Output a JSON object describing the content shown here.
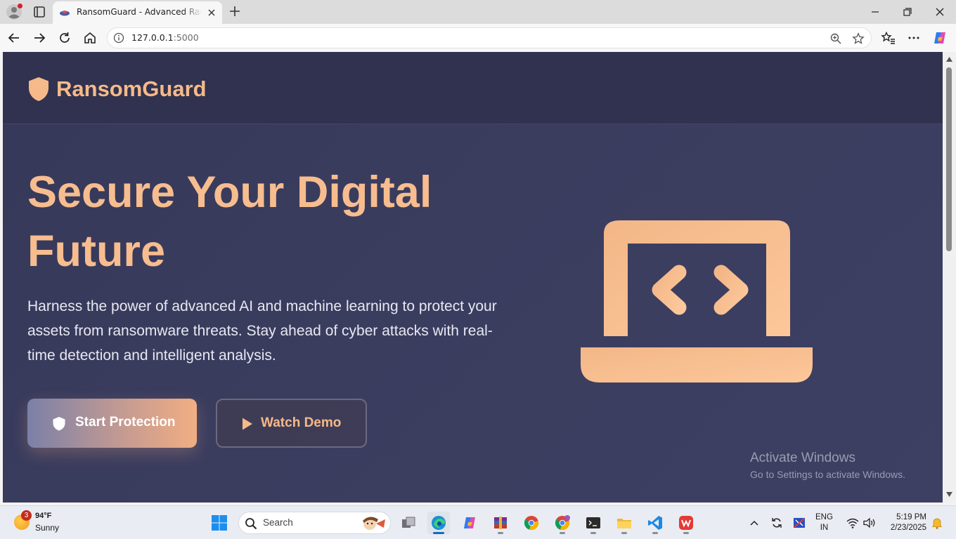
{
  "browser": {
    "tab_title": "RansomGuard - Advanced Ransomware Protection",
    "url_host": "127.0.0.1",
    "url_port": ":5000"
  },
  "site": {
    "brand": "RansomGuard",
    "hero_title": "Secure Your Digital Future",
    "hero_description": "Harness the power of advanced AI and machine learning to protect your assets from ransomware threats. Stay ahead of cyber attacks with real-time detection and intelligent analysis.",
    "primary_button": "Start Protection",
    "secondary_button": "Watch Demo",
    "accent_color": "#f6b98a",
    "background_color": "#3a3c5e"
  },
  "watermark": {
    "line1": "Activate Windows",
    "line2": "Go to Settings to activate Windows."
  },
  "taskbar": {
    "weather_badge": "3",
    "weather_temp": "94°F",
    "weather_condition": "Sunny",
    "search_label": "Search",
    "lang_line1": "ENG",
    "lang_line2": "IN",
    "time": "5:19 PM",
    "date": "2/23/2025",
    "apps": [
      "file-explorer-tasks",
      "edge",
      "copilot",
      "winrar",
      "chrome",
      "chrome-profile",
      "terminal",
      "folder",
      "vscode",
      "wps-office"
    ]
  }
}
